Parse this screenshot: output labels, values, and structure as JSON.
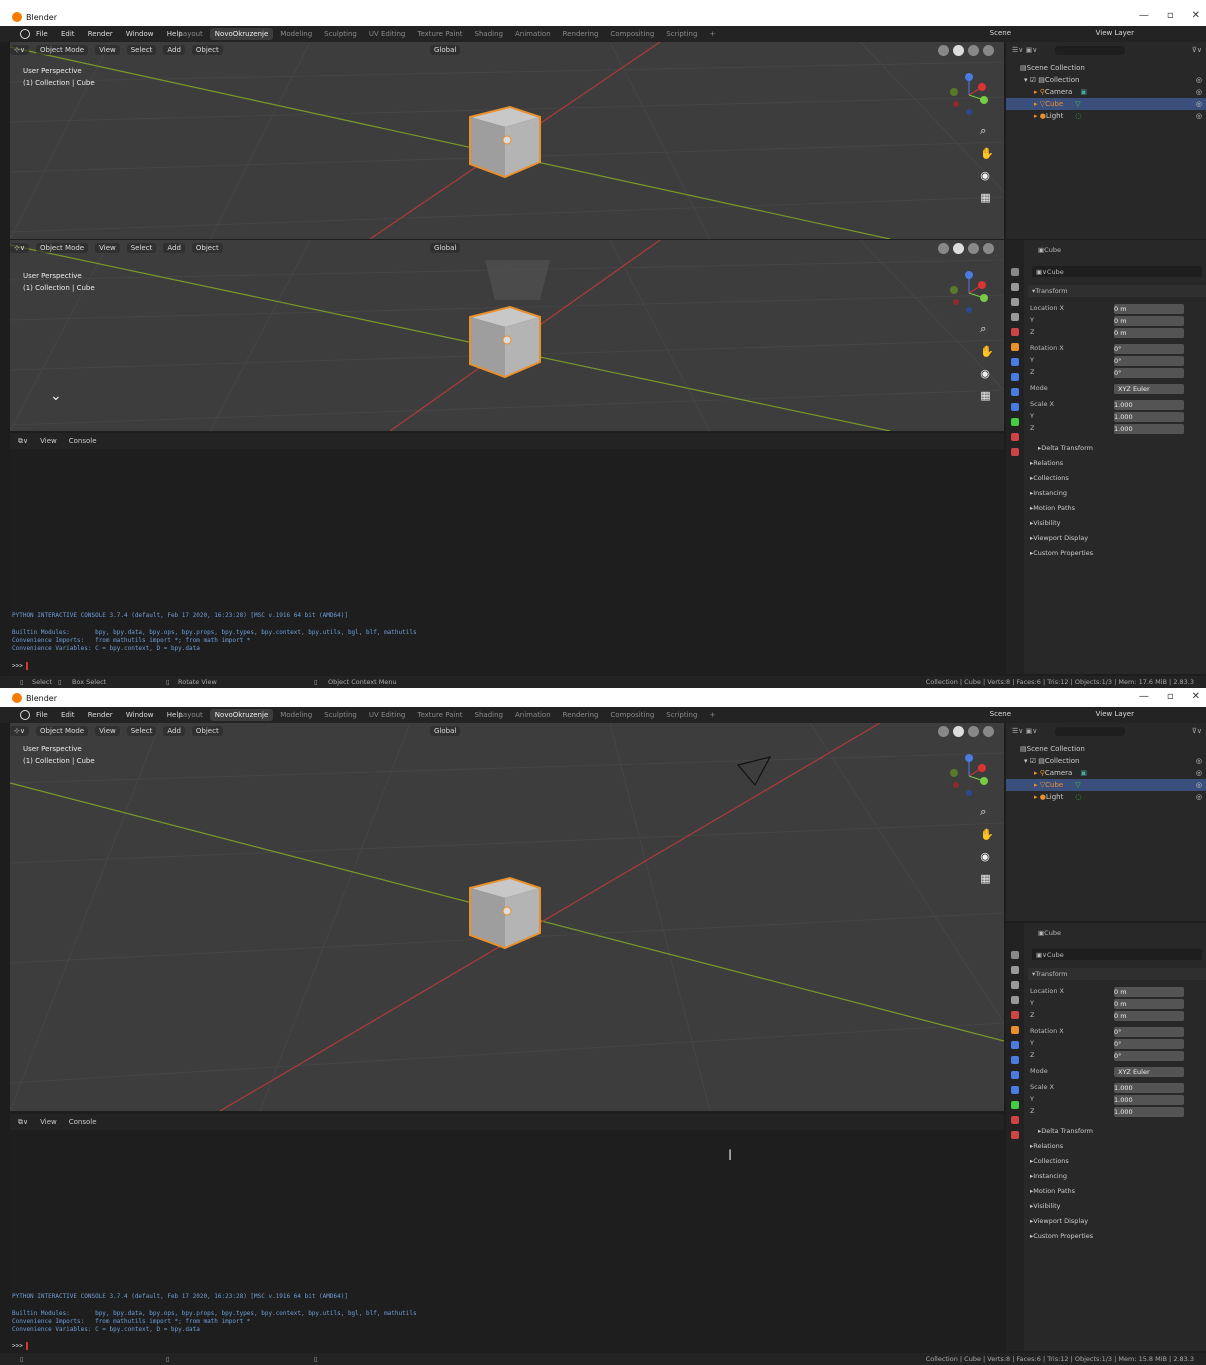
{
  "app": {
    "title": "Blender",
    "minimize": "—",
    "maximize": "▫",
    "close": "✕"
  },
  "menu": [
    "File",
    "Edit",
    "Render",
    "Window",
    "Help"
  ],
  "tabs": [
    "Layout",
    "NovoOkruzenje",
    "Modeling",
    "Sculpting",
    "UV Editing",
    "Texture Paint",
    "Shading",
    "Animation",
    "Rendering",
    "Compositing",
    "Scripting",
    "+"
  ],
  "scene_label": "Scene",
  "view_layer_label": "View Layer",
  "viewport": {
    "mode": "Object Mode",
    "menus": [
      "View",
      "Select",
      "Add",
      "Object"
    ],
    "orientation": "Global",
    "info_line1": "User Perspective",
    "info_line2": "(1) Collection | Cube"
  },
  "outliner": {
    "search_placeholder": "",
    "items": [
      "Scene Collection",
      "Collection",
      "Camera",
      "Cube",
      "Light"
    ]
  },
  "properties": {
    "object_name": "Cube",
    "data_name": "Cube",
    "transform_label": "Transform",
    "location_label": "Location X",
    "rotation_label": "Rotation X",
    "mode_label": "Mode",
    "scale_label": "Scale X",
    "y": "Y",
    "z": "Z",
    "location": [
      "0 m",
      "0 m",
      "0 m"
    ],
    "rotation": [
      "0°",
      "0°",
      "0°"
    ],
    "mode": "XYZ Euler",
    "scale": [
      "1.000",
      "1.000",
      "1.000"
    ],
    "sections": [
      "Delta Transform",
      "Relations",
      "Collections",
      "Instancing",
      "Motion Paths",
      "Visibility",
      "Viewport Display",
      "Custom Properties"
    ]
  },
  "console": {
    "menus": [
      "View",
      "Console"
    ],
    "line1": "PYTHON INTERACTIVE CONSOLE 3.7.4 (default, Feb 17 2020, 16:23:28) [MSC v.1916 64 bit (AMD64)]",
    "line2": "Builtin Modules:       bpy, bpy.data, bpy.ops, bpy.props, bpy.types, bpy.context, bpy.utils, bgl, blf, mathutils",
    "line3": "Convenience Imports:   from mathutils import *; from math import *",
    "line4": "Convenience Variables: C = bpy.context, D = bpy.data",
    "prompt": ">>> "
  },
  "status1": {
    "select": "Select",
    "box_select": "Box Select",
    "rotate_view": "Rotate View",
    "context_menu": "Object Context Menu",
    "stats": "Collection | Cube | Verts:8 | Faces:6 | Tris:12 | Objects:1/3 | Mem: 17.6 MiB | 2.83.3"
  },
  "status2": {
    "stats": "Collection | Cube | Verts:8 | Faces:6 | Tris:12 | Objects:1/3 | Mem: 15.8 MiB | 2.83.3"
  },
  "colors": {
    "accent": "#e8912d",
    "selection": "#3b4f7d",
    "x_axis": "#b03a3a",
    "y_axis": "#7a9a2a",
    "console_text": "#6f9fd8"
  }
}
